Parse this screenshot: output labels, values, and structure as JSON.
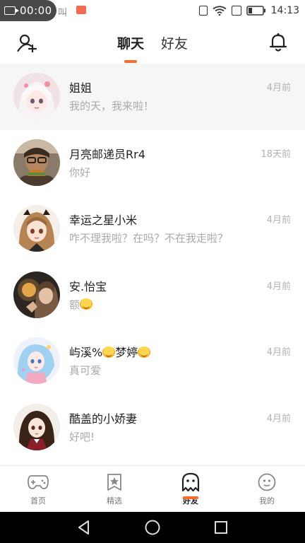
{
  "status_bar": {
    "recording_time": "00:00",
    "ghost_text": "叫",
    "clock": "14:13"
  },
  "header": {
    "tabs": [
      {
        "label": "聊天",
        "active": true
      },
      {
        "label": "好友",
        "active": false
      }
    ],
    "accent_color": "#ff6a2a"
  },
  "chats": [
    {
      "name": "姐姐",
      "preview": "我的天，我来啦！",
      "date": "4月前",
      "emoji": false,
      "highlight": true
    },
    {
      "name": "月亮邮递员Rr4",
      "preview": "你好",
      "date": "18天前",
      "emoji": false,
      "highlight": false
    },
    {
      "name": "幸运之星小米",
      "preview": "咋不理我啦？在吗？不在我走啦？",
      "date": "4月前",
      "emoji": false,
      "highlight": false
    },
    {
      "name": "安.怡宝",
      "preview": "额",
      "date": "4月前",
      "emoji": true,
      "highlight": false
    },
    {
      "name": "屿溪%",
      "name_suffix": "梦婷",
      "preview": "真可爱",
      "date": "4月前",
      "emoji": false,
      "highlight": false
    },
    {
      "name": "酷盖的小娇妻",
      "preview": "好吧!",
      "date": "4月前",
      "emoji": false,
      "highlight": false
    }
  ],
  "bottom_nav": [
    {
      "label": "首页",
      "icon": "gamepad-icon",
      "active": false
    },
    {
      "label": "精选",
      "icon": "star-icon",
      "active": false
    },
    {
      "label": "好友",
      "icon": "ghost-icon",
      "active": true
    },
    {
      "label": "我的",
      "icon": "face-icon",
      "active": false
    }
  ]
}
